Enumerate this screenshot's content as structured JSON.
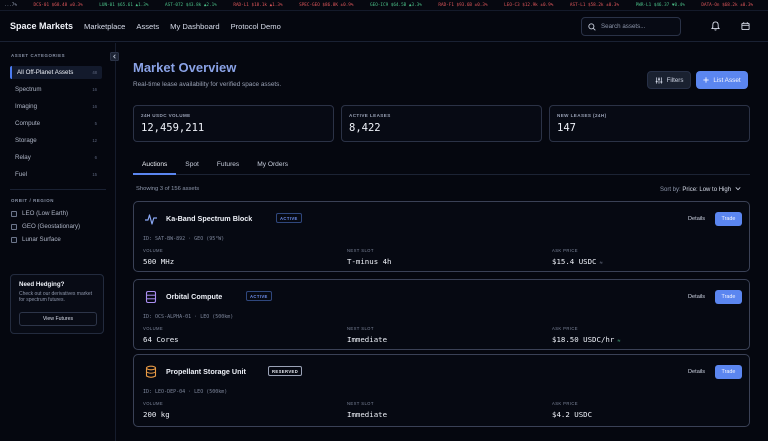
{
  "ticker": [
    {
      "label": "...7%",
      "dir": ""
    },
    {
      "label": "DCS-01 $68.48 ±0.3%",
      "dir": "dn"
    },
    {
      "label": "LUN-01 $65.61 ▲1.3%",
      "dir": "up"
    },
    {
      "label": "AST-072 $43.8k ▲2.1%",
      "dir": "up"
    },
    {
      "label": "RAD-L1 $18.1k ▲1.3%",
      "dir": "dn"
    },
    {
      "label": "SPEC-GEO $86.8K ±0.9%",
      "dir": "dn"
    },
    {
      "label": "GEO-IC9 $64.5B ▲3.3%",
      "dir": "up"
    },
    {
      "label": "RAD-F1 $93.6B ±0.3%",
      "dir": "dn"
    },
    {
      "label": "LEO-C3 $12.9k ±0.9%",
      "dir": "dn"
    },
    {
      "label": "AST-L1 $58.2k ±0.3%",
      "dir": "dn"
    },
    {
      "label": "PWR-L1 $46.37 ▼0.4%",
      "dir": "up"
    },
    {
      "label": "DATA-On $68.2k ±0.3%",
      "dir": "dn"
    }
  ],
  "header": {
    "brand": "Space Markets",
    "nav": [
      "Marketplace",
      "Assets",
      "My Dashboard",
      "Protocol Demo"
    ],
    "search_placeholder": "Search assets..."
  },
  "sidebar": {
    "categories_title": "ASSET CATEGORIES",
    "categories": [
      {
        "label": "All Off-Planet Assets",
        "count": "48",
        "active": true
      },
      {
        "label": "Spectrum",
        "count": "16",
        "active": false
      },
      {
        "label": "Imaging",
        "count": "16",
        "active": false
      },
      {
        "label": "Compute",
        "count": "5",
        "active": false
      },
      {
        "label": "Storage",
        "count": "12",
        "active": false
      },
      {
        "label": "Relay",
        "count": "6",
        "active": false
      },
      {
        "label": "Fuel",
        "count": "15",
        "active": false
      }
    ],
    "orbit_title": "ORBIT / REGION",
    "orbits": [
      "LEO (Low Earth)",
      "GEO (Geostationary)",
      "Lunar Surface"
    ],
    "hedge": {
      "title": "Need Hedging?",
      "text": "Check out our derivatives market for spectrum futures.",
      "button": "View Futures"
    }
  },
  "main": {
    "title": "Market Overview",
    "subtitle": "Real-time lease availability for verified space assets.",
    "filters_label": "Filters",
    "list_label": "List Asset",
    "stats": [
      {
        "label": "24H USDC VOLUME",
        "value": "12,459,211"
      },
      {
        "label": "ACTIVE LEASES",
        "value": "8,422"
      },
      {
        "label": "NEW LEASES (24H)",
        "value": "147"
      }
    ],
    "tabs": [
      "Auctions",
      "Spot",
      "Futures",
      "My Orders"
    ],
    "showing": "Showing 3 of 156 assets",
    "sort_label": "Sort by:",
    "sort_value": "Price: Low to High",
    "assets": [
      {
        "name": "Ka-Band Spectrum Block",
        "badge": "ACTIVE",
        "id": "ID: SAT-BW-892 · GEO (95°W)",
        "col1_label": "VOLUME",
        "col1_value": "500 MHz",
        "col2_label": "NEXT SLOT",
        "col2_value": "T-minus 4h",
        "col3_label": "ASK PRICE",
        "col3_value": "$15.4 USDC",
        "trend": "≈",
        "details": "Details",
        "trade": "Trade",
        "icon": "pulse-icon"
      },
      {
        "name": "Orbital Compute",
        "badge": "ACTIVE",
        "id": "ID: OCS-ALPHA-01 · LEO (500km)",
        "col1_label": "VOLUME",
        "col1_value": "64 Cores",
        "col2_label": "NEXT SLOT",
        "col2_value": "Immediate",
        "col3_label": "ASK PRICE",
        "col3_value": "$18.50 USDC/hr",
        "trend": "≈",
        "details": "Details",
        "trade": "Trade",
        "icon": "server-icon"
      },
      {
        "name": "Propellant Storage Unit",
        "badge": "RESERVED",
        "id": "ID: LEO-DEP-04 · LEO (500km)",
        "col1_label": "VOLUME",
        "col1_value": "200 kg",
        "col2_label": "NEXT SLOT",
        "col2_value": "Immediate",
        "col3_label": "ASK PRICE",
        "col3_value": "$4.2 USDC",
        "trend": "",
        "details": "Details",
        "trade": "Trade",
        "icon": "database-icon"
      }
    ]
  },
  "colors": {
    "accent": "#5b86f0",
    "title": "#8aa2e6",
    "up": "#4cc38a",
    "down": "#e0575b"
  }
}
